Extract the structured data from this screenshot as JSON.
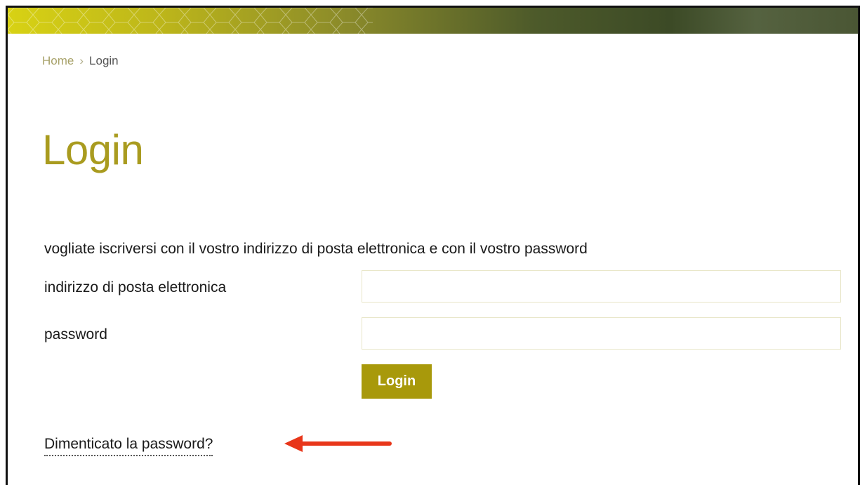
{
  "breadcrumb": {
    "home": "Home",
    "separator": "›",
    "current": "Login"
  },
  "page": {
    "title": "Login",
    "intro": "vogliate iscriversi con il vostro indirizzo di posta elettronica e con il vostro password"
  },
  "form": {
    "email_label": "indirizzo di posta elettronica",
    "email_value": "",
    "password_label": "password",
    "password_value": "",
    "submit_label": "Login"
  },
  "links": {
    "forgot_password": "Dimenticato la password?"
  },
  "annotation": {
    "icon": "red-arrow-icon",
    "color": "#e8361a"
  },
  "colors": {
    "accent": "#a8990b",
    "title": "#a99b1f",
    "breadcrumb_link": "#a8a26a"
  }
}
